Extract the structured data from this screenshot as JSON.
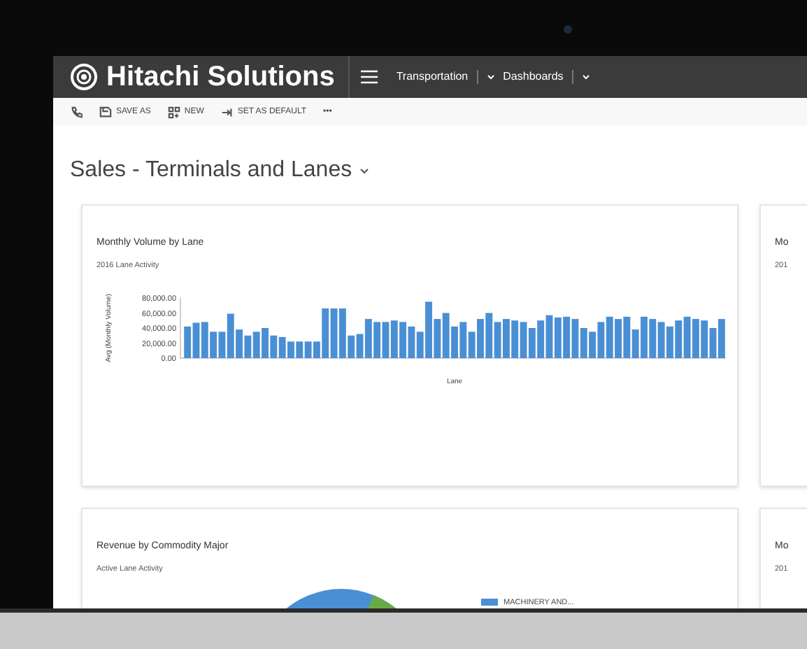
{
  "app": {
    "brand": "Hitachi Solutions",
    "nav": [
      {
        "label": "Transportation"
      },
      {
        "label": "Dashboards"
      }
    ]
  },
  "toolbar": [
    {
      "kind": "phone"
    },
    {
      "kind": "save",
      "label": "SAVE AS"
    },
    {
      "kind": "new",
      "label": "NEW"
    },
    {
      "kind": "default",
      "label": "SET AS DEFAULT"
    },
    {
      "kind": "more",
      "label": "•••"
    }
  ],
  "dashboard": {
    "title": "Sales - Terminals and Lanes"
  },
  "cards": [
    {
      "title": "Monthly Volume by Lane",
      "subtitle": "2016 Lane Activity",
      "chart_data": {
        "type": "bar",
        "xlabel": "Lane",
        "ylabel": "Avg (Monthly Volume)",
        "ylim": [
          0,
          80000
        ],
        "yticks": [
          {
            "value": 0,
            "label": "0.00"
          },
          {
            "value": 20000,
            "label": "20,000.00"
          },
          {
            "value": 40000,
            "label": "40,000.00"
          },
          {
            "value": 60000,
            "label": "60,000.00"
          },
          {
            "value": 80000,
            "label": "80,000.00"
          }
        ],
        "series": [
          {
            "color": "#4a8fd4",
            "values": [
              42000,
              47000,
              48000,
              35000,
              35000,
              59000,
              38000,
              30000,
              35000,
              40000,
              30000,
              28000,
              22000,
              22000,
              22000,
              22000,
              66000,
              66000,
              66000,
              30000,
              32000,
              52000,
              48000,
              48000,
              50000,
              48000,
              42000,
              35000,
              75000,
              52000,
              60000,
              42000,
              48000,
              35000,
              52000,
              60000,
              48000,
              52000,
              50000,
              48000,
              40000,
              50000,
              57000,
              54000,
              55000,
              52000,
              40000,
              35000,
              48000,
              55000,
              52000,
              55000,
              38000,
              55000,
              52000,
              48000,
              42000,
              50000,
              55000,
              52000,
              50000,
              40000,
              52000
            ]
          }
        ]
      }
    },
    {
      "title": "Mo",
      "subtitle": "201"
    },
    {
      "title": "Revenue by Commodity Major",
      "subtitle": "Active Lane Activity",
      "legend": [
        {
          "label": "MACHINERY AND...",
          "color": "#4a8fd4"
        }
      ]
    },
    {
      "title": "Mo",
      "subtitle": "201"
    }
  ]
}
